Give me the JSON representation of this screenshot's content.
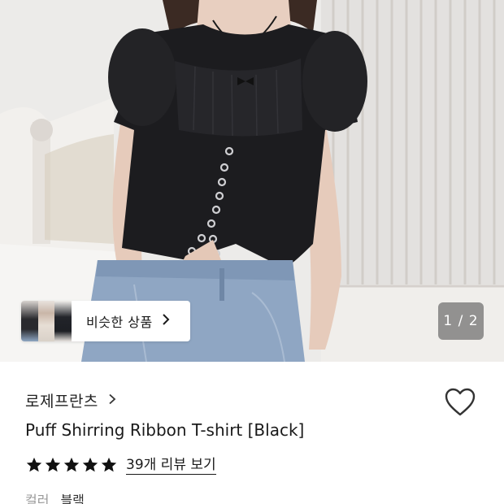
{
  "hero": {
    "similar_button": {
      "label": "비슷한 상품"
    },
    "page_indicator": "1 / 2"
  },
  "product": {
    "brand": "로제프란츠",
    "title": "Puff Shirring Ribbon T-shirt [Black]",
    "rating": {
      "stars": 5,
      "max": 5,
      "review_link": "39개 리뷰 보기"
    },
    "option": {
      "label": "컬러",
      "value": "블랙"
    }
  },
  "icons": {
    "brand_chevron": "chevron-right-icon",
    "similar_chevron": "chevron-right-icon",
    "wishlist": "heart-outline-icon",
    "star": "star-filled-icon"
  },
  "colors": {
    "text_primary": "#1a1a1a",
    "text_muted": "#9a9a9a",
    "star": "#111111",
    "indicator_bg": "#464646"
  }
}
